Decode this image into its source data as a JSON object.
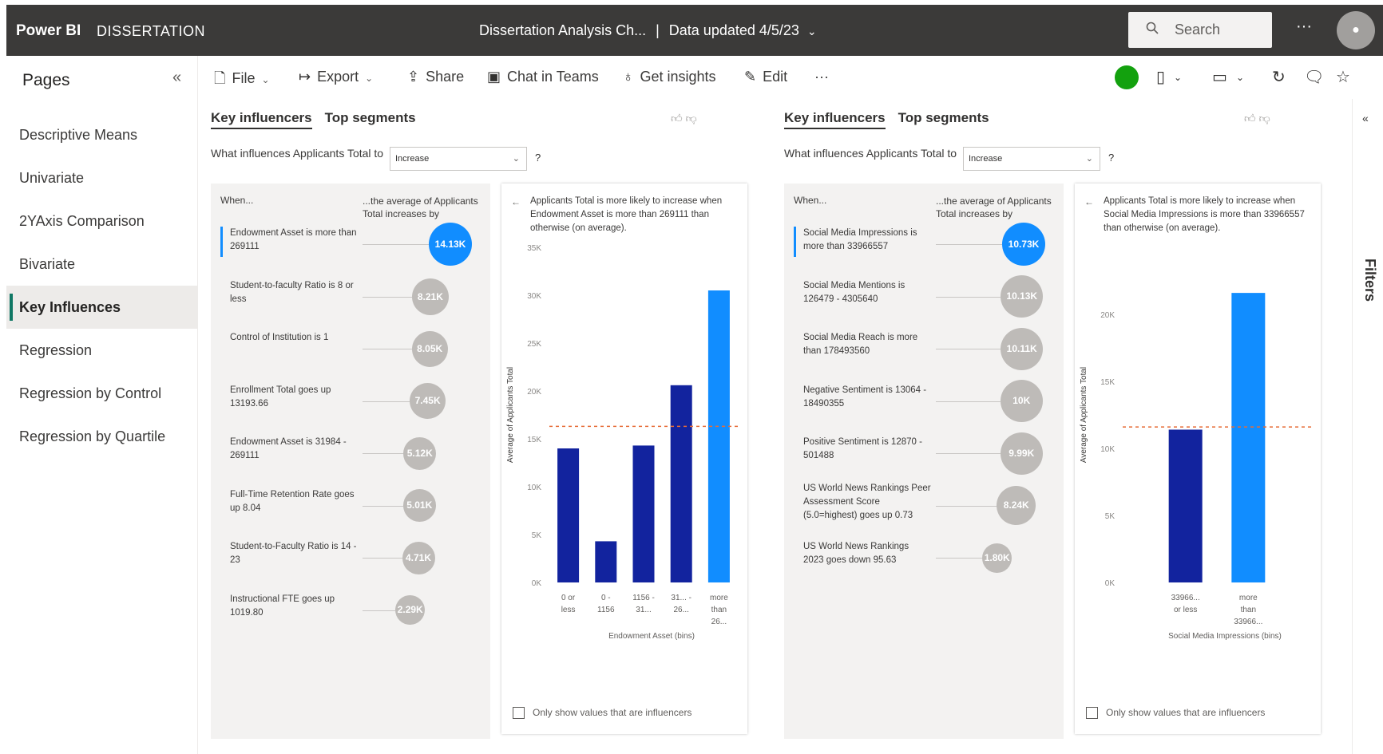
{
  "topbar": {
    "brand": "Power BI",
    "workspace": "DISSERTATION",
    "report_title": "Dissertation Analysis Ch...",
    "data_updated": "Data updated 4/5/23",
    "search_placeholder": "Search",
    "more": "···"
  },
  "pages": {
    "header": "Pages",
    "items": [
      {
        "label": "Descriptive Means"
      },
      {
        "label": "Univariate"
      },
      {
        "label": "2YAxis Comparison"
      },
      {
        "label": "Bivariate"
      },
      {
        "label": "Key Influences"
      },
      {
        "label": "Regression"
      },
      {
        "label": "Regression by Control"
      },
      {
        "label": "Regression by Quartile"
      }
    ],
    "active_index": 4
  },
  "toolbar": {
    "file": "File",
    "export": "Export",
    "share": "Share",
    "chat": "Chat in Teams",
    "insights": "Get insights",
    "edit": "Edit",
    "more": "···"
  },
  "filters_label": "Filters",
  "visuals": [
    {
      "tab_key": "Key influencers",
      "tab_top": "Top segments",
      "question": "What influences Applicants Total to",
      "select_value": "Increase",
      "help": "?",
      "col_when": "When...",
      "col_avg": "...the average of Applicants Total increases by",
      "influencers": [
        {
          "label": "Endowment Asset is more than 269111",
          "value": "14.13K",
          "selected": true
        },
        {
          "label": "Student-to-faculty Ratio is 8 or less",
          "value": "8.21K"
        },
        {
          "label": "Control of Institution is 1",
          "value": "8.05K"
        },
        {
          "label": "Enrollment Total goes up 13193.66",
          "value": "7.45K"
        },
        {
          "label": "Endowment Asset is 31984 - 269111",
          "value": "5.12K"
        },
        {
          "label": "Full-Time Retention Rate goes up 8.04",
          "value": "5.01K"
        },
        {
          "label": "Student-to-Faculty Ratio is 14 - 23",
          "value": "4.71K"
        },
        {
          "label": "Instructional FTE goes up 1019.80",
          "value": "2.29K"
        }
      ],
      "panel_text": "Applicants Total is more likely to increase when Endowment Asset is more than 269111 than otherwise (on average).",
      "footer": "Only show values that are influencers",
      "chart_data": {
        "type": "bar",
        "ylabel": "Average of Applicants Total",
        "xlabel": "Endowment Asset (bins)",
        "ylim": [
          0,
          35000
        ],
        "yticks": [
          "0K",
          "5K",
          "10K",
          "15K",
          "20K",
          "25K",
          "30K",
          "35K"
        ],
        "categories": [
          "0 or less",
          "0 - 1156",
          "1156 - 31...",
          "31... - 26...",
          "more than 26..."
        ],
        "values": [
          14000,
          4300,
          14300,
          20600,
          30500
        ],
        "highlight_index": 4,
        "average_line": 16300
      }
    },
    {
      "tab_key": "Key influencers",
      "tab_top": "Top segments",
      "question": "What influences Applicants Total to",
      "select_value": "Increase",
      "help": "?",
      "col_when": "When...",
      "col_avg": "...the average of Applicants Total increases by",
      "influencers": [
        {
          "label": "Social Media Impressions is more than 33966557",
          "value": "10.73K",
          "selected": true
        },
        {
          "label": "Social Media Mentions is 126479 - 4305640",
          "value": "10.13K"
        },
        {
          "label": "Social Media Reach is more than 178493560",
          "value": "10.11K"
        },
        {
          "label": "Negative Sentiment is 13064 - 18490355",
          "value": "10K"
        },
        {
          "label": "Positive Sentiment is 12870 - 501488",
          "value": "9.99K"
        },
        {
          "label": "US World News Rankings Peer Assessment Score (5.0=highest) goes up 0.73",
          "value": "8.24K"
        },
        {
          "label": "US World News Rankings 2023 goes down 95.63",
          "value": "1.80K"
        }
      ],
      "panel_text": "Applicants Total is more likely to increase when Social Media Impressions is more than 33966557 than otherwise (on average).",
      "footer": "Only show values that are influencers",
      "chart_data": {
        "type": "bar",
        "ylabel": "Average of Applicants Total",
        "xlabel": "Social Media Impressions (bins)",
        "ylim": [
          0,
          25000
        ],
        "yticks": [
          "0K",
          "5K",
          "10K",
          "15K",
          "20K"
        ],
        "categories": [
          "33966... or less",
          "more than 33966..."
        ],
        "values": [
          11400,
          21600
        ],
        "highlight_index": 1,
        "average_line": 11600
      }
    }
  ],
  "colors": {
    "highlight": "#118dff",
    "bar": "#12239e",
    "avg_line": "#e66c37",
    "brand_bar": "#3b3a39"
  }
}
